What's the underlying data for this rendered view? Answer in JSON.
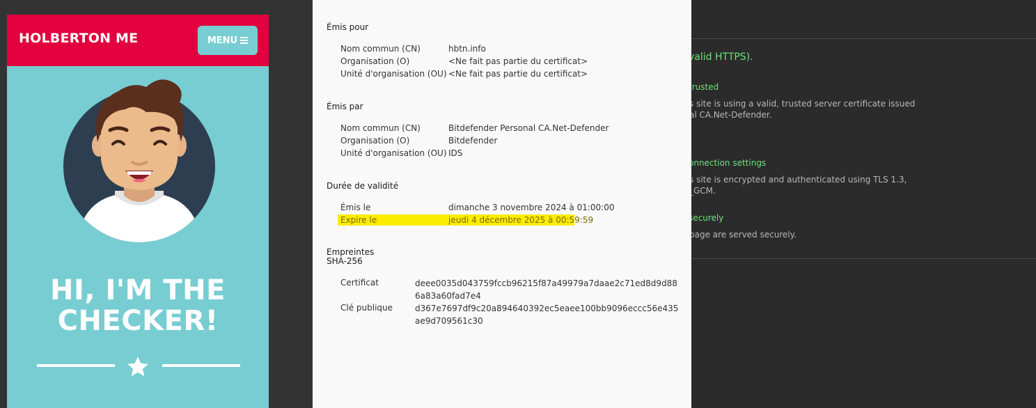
{
  "phone": {
    "brand": "HOLBERTON ME",
    "menu_label": "MENU",
    "hero_line1": "HI, I'M THE",
    "hero_line2": "CHECKER!",
    "colors": {
      "header": "#e2003e",
      "background": "#77cdd2"
    }
  },
  "certificate": {
    "issued_to": {
      "heading": "Émis pour",
      "rows": [
        {
          "label": "Nom commun (CN)",
          "value": "hbtn.info"
        },
        {
          "label": "Organisation (O)",
          "value": "<Ne fait pas partie du certificat>"
        },
        {
          "label": "Unité d'organisation (OU)",
          "value": "<Ne fait pas partie du certificat>"
        }
      ]
    },
    "issued_by": {
      "heading": "Émis par",
      "rows": [
        {
          "label": "Nom commun (CN)",
          "value": "Bitdefender Personal CA.Net-Defender"
        },
        {
          "label": "Organisation (O)",
          "value": "Bitdefender"
        },
        {
          "label": "Unité d'organisation (OU)",
          "value": "IDS"
        }
      ]
    },
    "validity": {
      "heading": "Durée de validité",
      "issued_label": "Émis le",
      "issued_value": "dimanche 3 novembre 2024 à 01:00:00",
      "expires_label": "Expire le",
      "expires_value": "jeudi 4 décembre 2025 à 00:59:59"
    },
    "fingerprints": {
      "heading": "Empreintes SHA-256",
      "cert_label": "Certificat",
      "cert_value": "deee0035d043759fccb96215f87a49979a7daae2c71ed8d9d886a83a60fad7e4",
      "key_label": "Clé publique",
      "key_value": "d367e7697df9c20a894640392ec5eaee100bb9096eccc56e435ae9d709561c30"
    }
  },
  "security_panel": {
    "headline": "valid HTTPS).",
    "cert_title": "trusted",
    "cert_text_1": "s site is using a valid, trusted server certificate issued",
    "cert_text_2": "al CA.Net-Defender.",
    "conn_title": "onnection settings",
    "conn_text_1": "s site is encrypted and authenticated using TLS 1.3,",
    "conn_text_2": "_GCM.",
    "res_title": "securely",
    "res_text": "page are served securely.",
    "accent": "#6ee37b"
  }
}
